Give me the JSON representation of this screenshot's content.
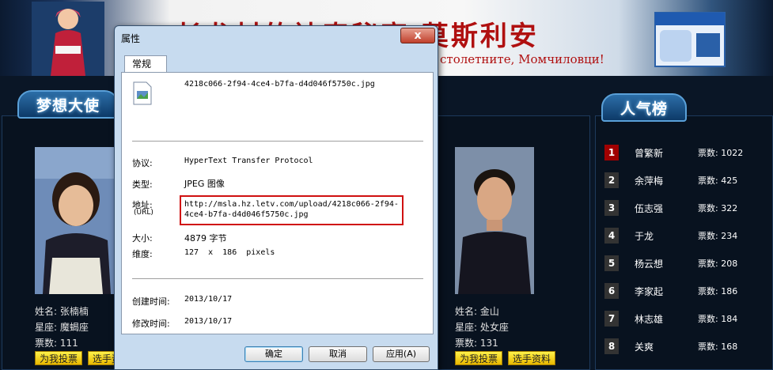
{
  "banner": {
    "title": "长龙村的神奇秘密 莫斯利安",
    "subtitle": "столетните, Момчиловци!"
  },
  "sections": {
    "dream_ambassador": "梦想大使",
    "popularity_rank": "人气榜"
  },
  "contestants": [
    {
      "name_line": "姓名: 张楠楠",
      "sign_line": "星座: 魔蝎座",
      "votes_line": "票数: 111",
      "vote_button": "为我投票",
      "info_button": "选手资料"
    },
    {
      "name_line": "姓名: 金山",
      "sign_line": "星座: 处女座",
      "votes_line": "票数: 131",
      "vote_button": "为我投票",
      "info_button": "选手资料"
    }
  ],
  "ranking": [
    {
      "rank": "1",
      "name": "曾繁新",
      "votes": "票数: 1022"
    },
    {
      "rank": "2",
      "name": "余萍梅",
      "votes": "票数: 425"
    },
    {
      "rank": "3",
      "name": "伍志强",
      "votes": "票数: 322"
    },
    {
      "rank": "4",
      "name": "于龙",
      "votes": "票数: 234"
    },
    {
      "rank": "5",
      "name": "杨云想",
      "votes": "票数: 208"
    },
    {
      "rank": "6",
      "name": "李家起",
      "votes": "票数: 186"
    },
    {
      "rank": "7",
      "name": "林志雄",
      "votes": "票数: 184"
    },
    {
      "rank": "8",
      "name": "关爽",
      "votes": "票数: 168"
    }
  ],
  "dialog": {
    "title": "属性",
    "close": "x",
    "tab": "常规",
    "filename": "4218c066-2f94-4ce4-b7fa-d4d046f5750c.jpg",
    "protocol_label": "协议:",
    "protocol_value": "HyperText Transfer Protocol",
    "type_label": "类型:",
    "type_value": "JPEG 图像",
    "address_label": "地址:",
    "address_sublabel": "(URL)",
    "address_line1": "http://msla.hz.letv.com/upload/4218c066-2f94-",
    "address_line2": "4ce4-b7fa-d4d046f5750c.jpg",
    "size_label": "大小:",
    "size_value": "4879 字节",
    "dimensions_label": "维度:",
    "dimensions_value": "127  x  186  pixels",
    "created_label": "创建时间:",
    "created_value": "2013/10/17",
    "modified_label": "修改时间:",
    "modified_value": "2013/10/17",
    "ok": "确定",
    "cancel": "取消",
    "apply": "应用(A)"
  },
  "colors": {
    "rank_top": "#a00000",
    "url_highlight": "#d01010",
    "vote_button": "#f5d000"
  }
}
